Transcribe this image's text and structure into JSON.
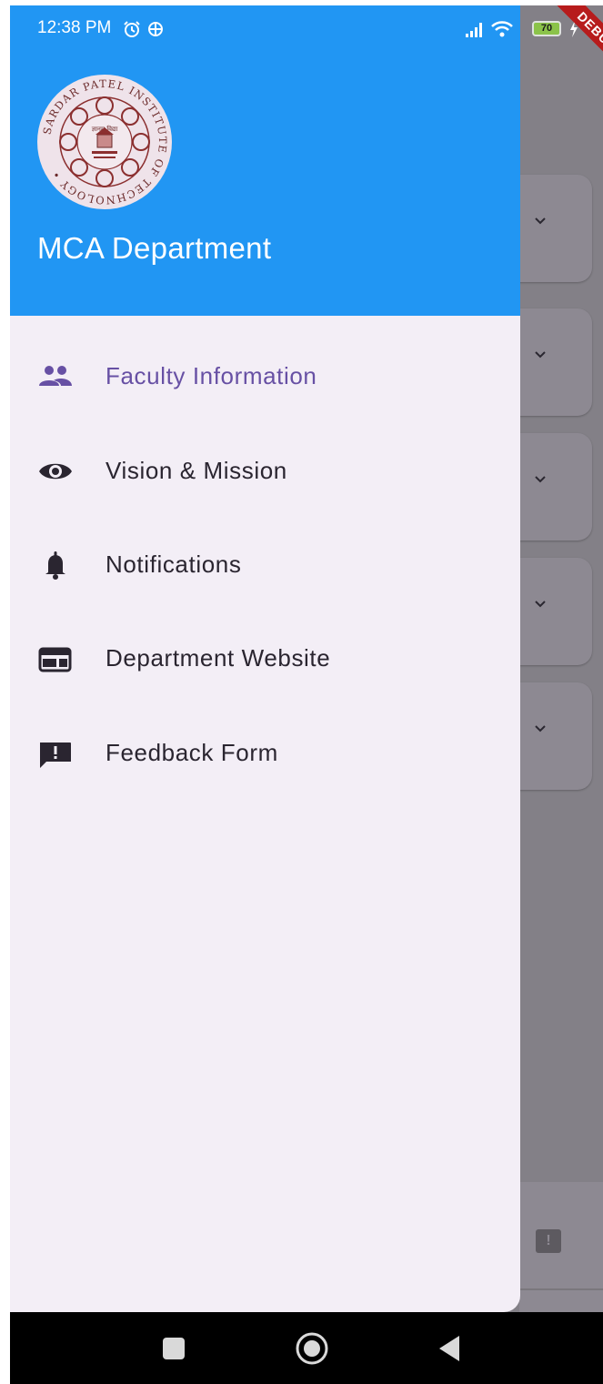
{
  "status_bar": {
    "time": "12:38 PM",
    "battery": "70",
    "icons": [
      "alarm-icon",
      "vpn-icon",
      "signal-icon",
      "wifi-icon",
      "battery-icon",
      "charging-icon"
    ]
  },
  "debug_banner": "DEBUG",
  "drawer": {
    "header_title": "MCA Department",
    "logo": {
      "ring_text": "SARDAR PATEL INSTITUTE OF TECHNOLOGY",
      "center_text": "ज्ञानम् विद्या"
    },
    "items": [
      {
        "label": "Faculty Information",
        "icon": "people-icon",
        "active": true
      },
      {
        "label": "Vision & Mission",
        "icon": "eye-icon",
        "active": false
      },
      {
        "label": "Notifications",
        "icon": "bell-icon",
        "active": false
      },
      {
        "label": "Department Website",
        "icon": "web-icon",
        "active": false
      },
      {
        "label": "Feedback Form",
        "icon": "feedback-icon",
        "active": false
      }
    ]
  },
  "colors": {
    "header": "#2196f3",
    "drawer_bg": "#f3eef6",
    "active": "#6750a4",
    "scrim": "#838087"
  },
  "nav_bar": {
    "buttons": [
      "recents-button",
      "home-button",
      "back-button"
    ]
  }
}
